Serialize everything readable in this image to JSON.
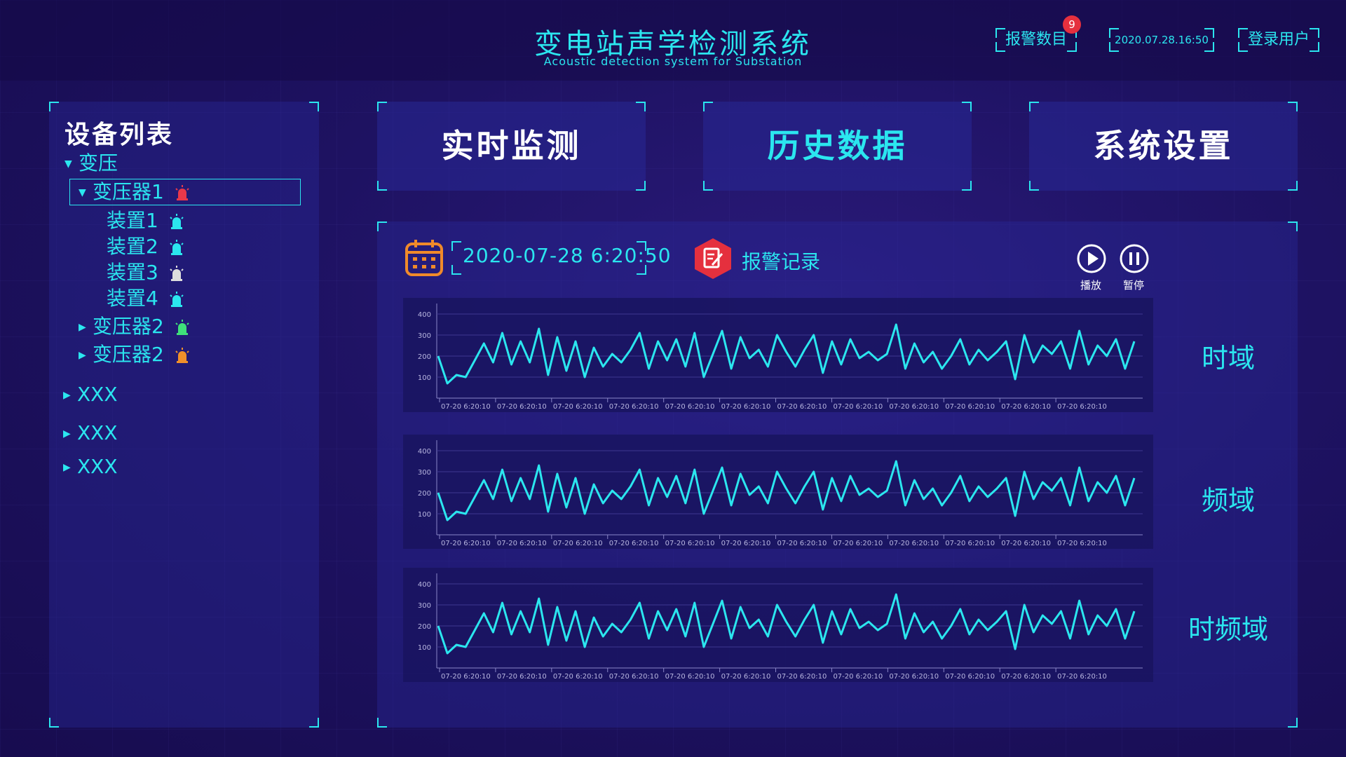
{
  "header": {
    "title": "变电站声学检测系统",
    "subtitle": "Acoustic detection system for Substation",
    "alarm_count_label": "报警数目",
    "alarm_count": "9",
    "datetime": "2020.07.28.16:50",
    "login_label": "登录用户"
  },
  "sidebar": {
    "title": "设备列表",
    "tree": {
      "root": "变压",
      "transformer1": "变压器1",
      "devices": [
        "装置1",
        "装置2",
        "装置3",
        "装置4"
      ],
      "transformer2a": "变压器2",
      "transformer2b": "变压器2",
      "others": [
        "XXX",
        "XXX",
        "XXX"
      ]
    },
    "alarm_colors": {
      "transformer1": "#e8384a",
      "device1": "#2be6ef",
      "device2": "#2be6ef",
      "device3": "#dddddd",
      "device4": "#2be6ef",
      "transformer2a": "#3fe07a",
      "transformer2b": "#f0902a"
    }
  },
  "nav": {
    "realtime": "实时监测",
    "history": "历史数据",
    "settings": "系统设置",
    "active": "history"
  },
  "toolbar": {
    "date": "2020-07-28 6:20:50",
    "alarm_record": "报警记录",
    "play_label": "播放",
    "pause_label": "暂停"
  },
  "views": {
    "time_domain": "时域",
    "freq_domain": "频域",
    "time_freq_domain": "时频域"
  },
  "colors": {
    "accent": "#2be6ef",
    "calendar": "#f08a2a",
    "record_icon": "#e5303e"
  },
  "chart_data": [
    {
      "type": "line",
      "yticks": [
        100,
        200,
        300,
        400
      ],
      "ylim": [
        0,
        450
      ],
      "x_tick_labels": [
        "07-20 6:20:10",
        "07-20 6:20:10",
        "07-20 6:20:10",
        "07-20 6:20:10",
        "07-20 6:20:10",
        "07-20 6:20:10",
        "07-20 6:20:10",
        "07-20 6:20:10",
        "07-20 6:20:10",
        "07-20 6:20:10",
        "07-20 6:20:10",
        "07-20 6:20:10"
      ],
      "values": [
        200,
        70,
        110,
        100,
        180,
        260,
        170,
        310,
        160,
        270,
        170,
        330,
        110,
        290,
        130,
        270,
        100,
        240,
        150,
        210,
        170,
        230,
        310,
        140,
        270,
        180,
        280,
        150,
        310,
        100,
        210,
        320,
        140,
        290,
        190,
        230,
        150,
        300,
        220,
        150,
        230,
        300,
        120,
        270,
        160,
        280,
        190,
        220,
        180,
        210,
        350,
        140,
        260,
        170,
        220,
        140,
        200,
        280,
        160,
        230,
        180,
        220,
        270,
        90,
        300,
        170,
        250,
        210,
        270,
        140,
        320,
        160,
        250,
        200,
        280,
        140,
        270
      ]
    },
    {
      "type": "line",
      "yticks": [
        100,
        200,
        300,
        400
      ],
      "ylim": [
        0,
        450
      ],
      "x_tick_labels": [
        "07-20 6:20:10",
        "07-20 6:20:10",
        "07-20 6:20:10",
        "07-20 6:20:10",
        "07-20 6:20:10",
        "07-20 6:20:10",
        "07-20 6:20:10",
        "07-20 6:20:10",
        "07-20 6:20:10",
        "07-20 6:20:10",
        "07-20 6:20:10",
        "07-20 6:20:10"
      ],
      "values": [
        200,
        70,
        110,
        100,
        180,
        260,
        170,
        310,
        160,
        270,
        170,
        330,
        110,
        290,
        130,
        270,
        100,
        240,
        150,
        210,
        170,
        230,
        310,
        140,
        270,
        180,
        280,
        150,
        310,
        100,
        210,
        320,
        140,
        290,
        190,
        230,
        150,
        300,
        220,
        150,
        230,
        300,
        120,
        270,
        160,
        280,
        190,
        220,
        180,
        210,
        350,
        140,
        260,
        170,
        220,
        140,
        200,
        280,
        160,
        230,
        180,
        220,
        270,
        90,
        300,
        170,
        250,
        210,
        270,
        140,
        320,
        160,
        250,
        200,
        280,
        140,
        270
      ]
    },
    {
      "type": "line",
      "yticks": [
        100,
        200,
        300,
        400
      ],
      "ylim": [
        0,
        450
      ],
      "x_tick_labels": [
        "07-20 6:20:10",
        "07-20 6:20:10",
        "07-20 6:20:10",
        "07-20 6:20:10",
        "07-20 6:20:10",
        "07-20 6:20:10",
        "07-20 6:20:10",
        "07-20 6:20:10",
        "07-20 6:20:10",
        "07-20 6:20:10",
        "07-20 6:20:10",
        "07-20 6:20:10"
      ],
      "values": [
        200,
        70,
        110,
        100,
        180,
        260,
        170,
        310,
        160,
        270,
        170,
        330,
        110,
        290,
        130,
        270,
        100,
        240,
        150,
        210,
        170,
        230,
        310,
        140,
        270,
        180,
        280,
        150,
        310,
        100,
        210,
        320,
        140,
        290,
        190,
        230,
        150,
        300,
        220,
        150,
        230,
        300,
        120,
        270,
        160,
        280,
        190,
        220,
        180,
        210,
        350,
        140,
        260,
        170,
        220,
        140,
        200,
        280,
        160,
        230,
        180,
        220,
        270,
        90,
        300,
        170,
        250,
        210,
        270,
        140,
        320,
        160,
        250,
        200,
        280,
        140,
        270
      ]
    }
  ]
}
